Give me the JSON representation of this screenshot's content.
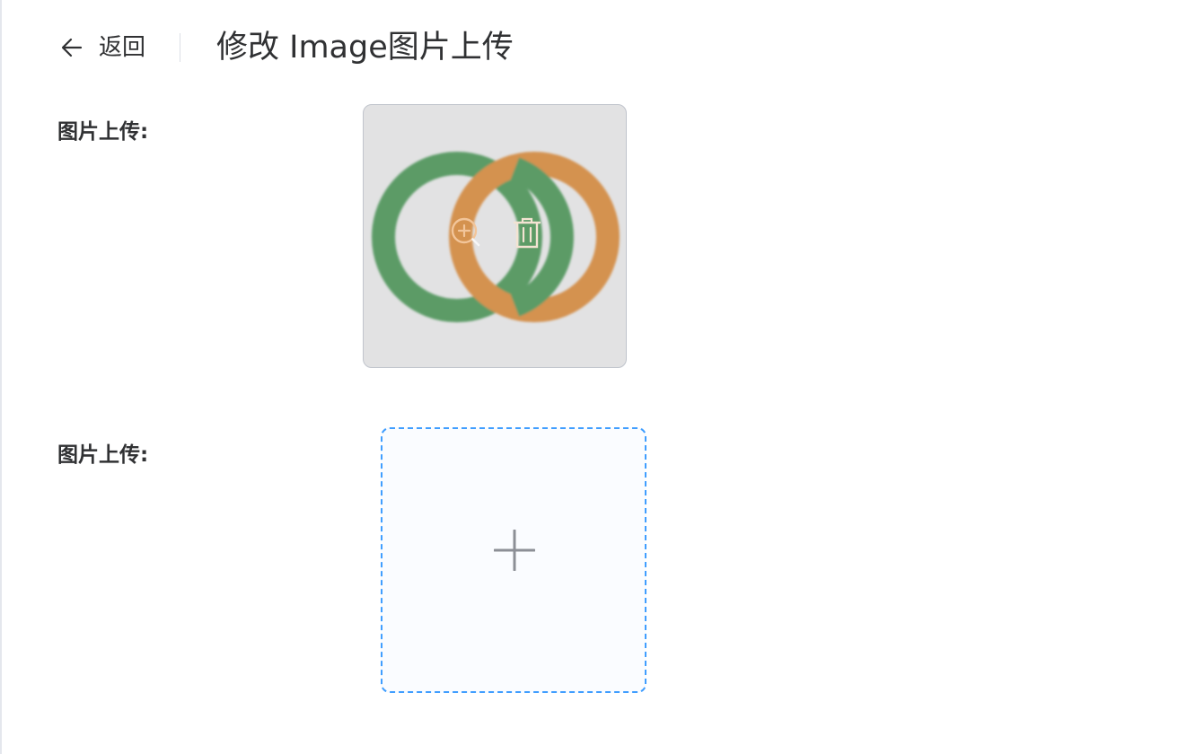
{
  "header": {
    "back_label": "返回",
    "title": "修改 Image图片上传"
  },
  "form": {
    "fields": [
      {
        "label": "图片上传:"
      },
      {
        "label": "图片上传:"
      }
    ]
  },
  "icons": {
    "back": "arrow-left-icon",
    "zoom": "zoom-in-icon",
    "delete": "trash-icon",
    "add": "plus-icon"
  },
  "colors": {
    "accent": "#409eff",
    "ring_green": "#5b9b66",
    "ring_orange": "#d4924f",
    "card_bg": "#e2e2e3"
  }
}
